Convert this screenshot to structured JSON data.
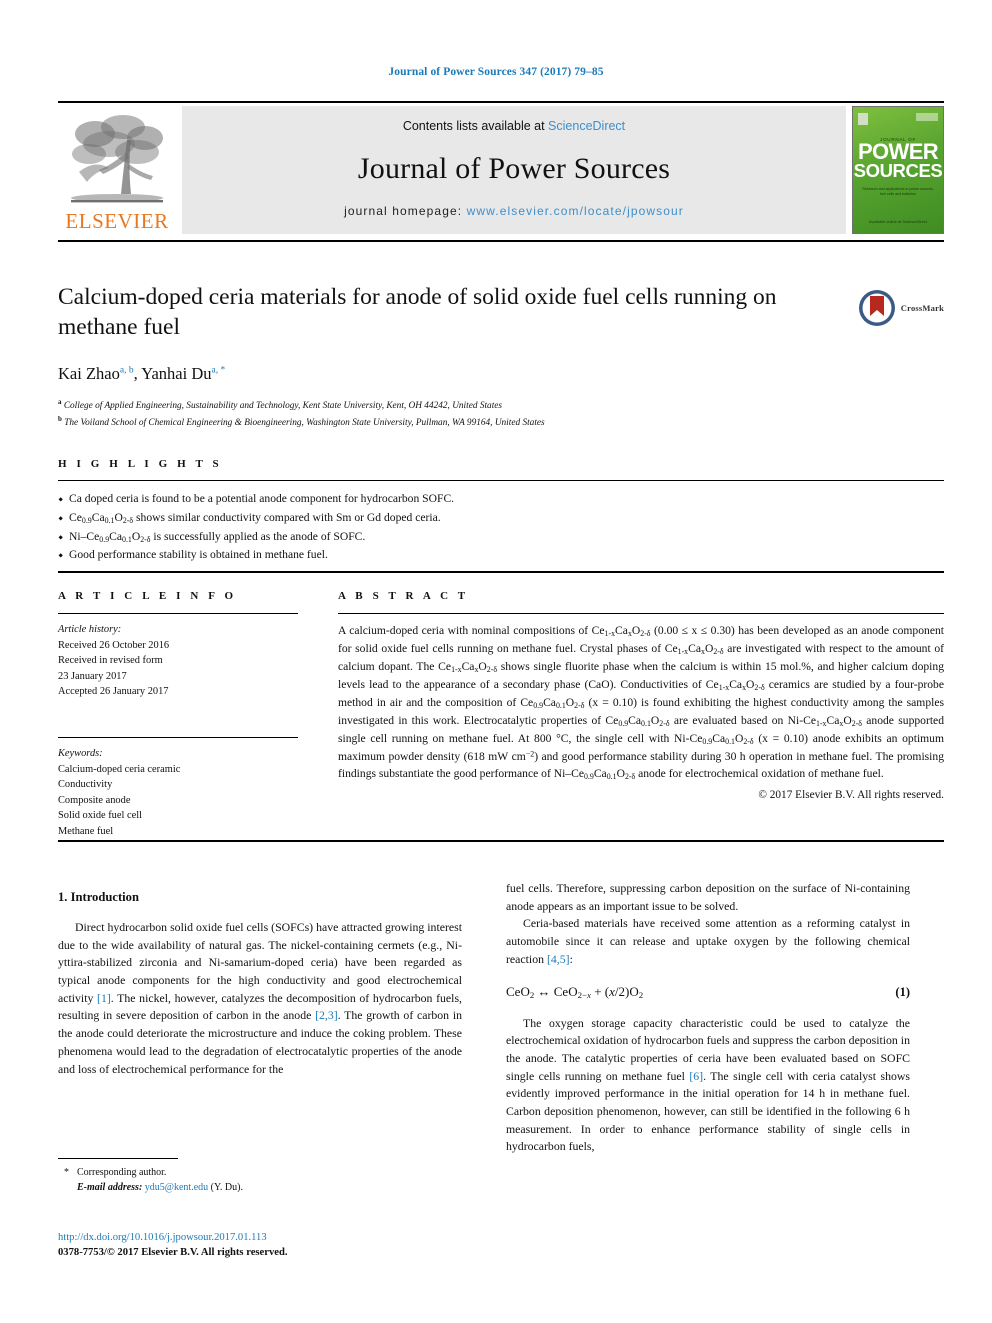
{
  "running_head": "Journal of Power Sources 347 (2017) 79–85",
  "banner": {
    "publisher": "ELSEVIER",
    "contents_prefix": "Contents lists available at ",
    "contents_link": "ScienceDirect",
    "journal_name": "Journal of Power Sources",
    "homepage_prefix": "journal homepage: ",
    "homepage_url": "www.elsevier.com/locate/jpowsour",
    "cover": {
      "kicker": "JOURNAL OF",
      "title_line1": "POWER",
      "title_line2": "SOURCES",
      "subtitle": "Research and applications in power sources, fuel cells and batteries",
      "footer": "Available online at\nScienceDirect"
    }
  },
  "article": {
    "title": "Calcium-doped ceria materials for anode of solid oxide fuel cells running on methane fuel",
    "authors": [
      {
        "name": "Kai Zhao",
        "marks": "a, b"
      },
      {
        "name": "Yanhai Du",
        "marks": "a, *"
      }
    ],
    "affiliations": [
      {
        "mark": "a",
        "text": "College of Applied Engineering, Sustainability and Technology, Kent State University, Kent, OH 44242, United States"
      },
      {
        "mark": "b",
        "text": "The Voiland School of Chemical Engineering & Bioengineering, Washington State University, Pullman, WA 99164, United States"
      }
    ],
    "crossmark_label": "CrossMark"
  },
  "highlights": {
    "label": "H I G H L I G H T S",
    "items": [
      "Ca doped ceria is found to be a potential anode component for hydrocarbon SOFC.",
      "Ce0.9Ca0.1O2-δ shows similar conductivity compared with Sm or Gd doped ceria.",
      "Ni-Ce0.9Ca0.1O2-δ is successfully applied as the anode of SOFC.",
      "Good performance stability is obtained in methane fuel."
    ]
  },
  "article_info": {
    "label": "A R T I C L E   I N F O",
    "history_label": "Article history:",
    "history": [
      "Received 26 October 2016",
      "Received in revised form",
      "23 January 2017",
      "Accepted 26 January 2017"
    ],
    "keywords_label": "Keywords:",
    "keywords": [
      "Calcium-doped ceria ceramic",
      "Conductivity",
      "Composite anode",
      "Solid oxide fuel cell",
      "Methane fuel"
    ]
  },
  "abstract": {
    "label": "A B S T R A C T",
    "copyright": "© 2017 Elsevier B.V. All rights reserved."
  },
  "body": {
    "section_number_title": "1.  Introduction",
    "equation_number": "(1)"
  },
  "footnote": {
    "star": "*",
    "corresponding": "Corresponding author.",
    "email_label": "E-mail address:",
    "email": "ydu5@kent.edu",
    "email_suffix": "(Y. Du)."
  },
  "footer": {
    "doi": "http://dx.doi.org/10.1016/j.jpowsour.2017.01.113",
    "rights": "0378-7753/© 2017 Elsevier B.V. All rights reserved."
  },
  "colors": {
    "link": "#1a7bb9",
    "elsevier_orange": "#E87722",
    "banner_grey": "#e8e8e8",
    "cover_green": "#58a430"
  }
}
